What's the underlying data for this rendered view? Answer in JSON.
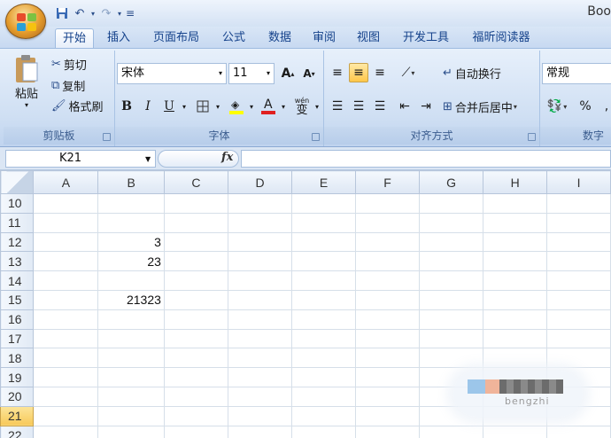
{
  "window": {
    "title": "Boo"
  },
  "qat": {
    "save_icon": "save-icon",
    "undo_icon": "undo-icon",
    "redo_icon": "redo-icon",
    "customize_icon": "customize-qat-icon"
  },
  "tabs": [
    {
      "label": "开始"
    },
    {
      "label": "插入"
    },
    {
      "label": "页面布局"
    },
    {
      "label": "公式"
    },
    {
      "label": "数据"
    },
    {
      "label": "审阅"
    },
    {
      "label": "视图"
    },
    {
      "label": "开发工具"
    },
    {
      "label": "福昕阅读器"
    }
  ],
  "clipboard": {
    "paste": "粘贴",
    "cut": "剪切",
    "copy": "复制",
    "format_painter": "格式刷",
    "group": "剪贴板"
  },
  "font": {
    "name": "宋体",
    "size": "11",
    "grow": "A",
    "shrink": "A",
    "bold": "B",
    "italic": "I",
    "underline": "U",
    "font_color_glyph": "A",
    "phonetic": "wén",
    "phonetic_glyph": "变",
    "group": "字体"
  },
  "alignment": {
    "wrap_text": "自动换行",
    "merge_center": "合并后居中",
    "group": "对齐方式"
  },
  "number": {
    "format": "常规",
    "percent": "%",
    "group": "数字"
  },
  "formula_bar": {
    "name_box": "K21",
    "fx": "fx",
    "value": ""
  },
  "grid": {
    "columns": [
      "A",
      "B",
      "C",
      "D",
      "E",
      "F",
      "G",
      "H",
      "I"
    ],
    "rows": [
      {
        "num": "10",
        "cells": [
          "",
          "",
          "",
          "",
          "",
          "",
          "",
          "",
          ""
        ]
      },
      {
        "num": "11",
        "cells": [
          "",
          "",
          "",
          "",
          "",
          "",
          "",
          "",
          ""
        ]
      },
      {
        "num": "12",
        "cells": [
          "",
          "3",
          "",
          "",
          "",
          "",
          "",
          "",
          ""
        ]
      },
      {
        "num": "13",
        "cells": [
          "",
          "23",
          "",
          "",
          "",
          "",
          "",
          "",
          ""
        ]
      },
      {
        "num": "14",
        "cells": [
          "",
          "",
          "",
          "",
          "",
          "",
          "",
          "",
          ""
        ]
      },
      {
        "num": "15",
        "cells": [
          "",
          "21323",
          "",
          "",
          "",
          "",
          "",
          "",
          ""
        ]
      },
      {
        "num": "16",
        "cells": [
          "",
          "",
          "",
          "",
          "",
          "",
          "",
          "",
          ""
        ]
      },
      {
        "num": "17",
        "cells": [
          "",
          "",
          "",
          "",
          "",
          "",
          "",
          "",
          ""
        ]
      },
      {
        "num": "18",
        "cells": [
          "",
          "",
          "",
          "",
          "",
          "",
          "",
          "",
          ""
        ]
      },
      {
        "num": "19",
        "cells": [
          "",
          "",
          "",
          "",
          "",
          "",
          "",
          "",
          ""
        ]
      },
      {
        "num": "20",
        "cells": [
          "",
          "",
          "",
          "",
          "",
          "",
          "",
          "",
          ""
        ]
      },
      {
        "num": "21",
        "cells": [
          "",
          "",
          "",
          "",
          "",
          "",
          "",
          "",
          ""
        ]
      },
      {
        "num": "22",
        "cells": [
          "",
          "",
          "",
          "",
          "",
          "",
          "",
          "",
          ""
        ]
      }
    ],
    "active_row": "21"
  },
  "watermark": {
    "text": "bengzhi"
  },
  "colors": {
    "ribbon": "#cfdff3",
    "tab_text": "#15428b",
    "highlight": "#ffc74a",
    "font_color_bar": "#e02020",
    "fill_color_bar": "#ffff00"
  }
}
